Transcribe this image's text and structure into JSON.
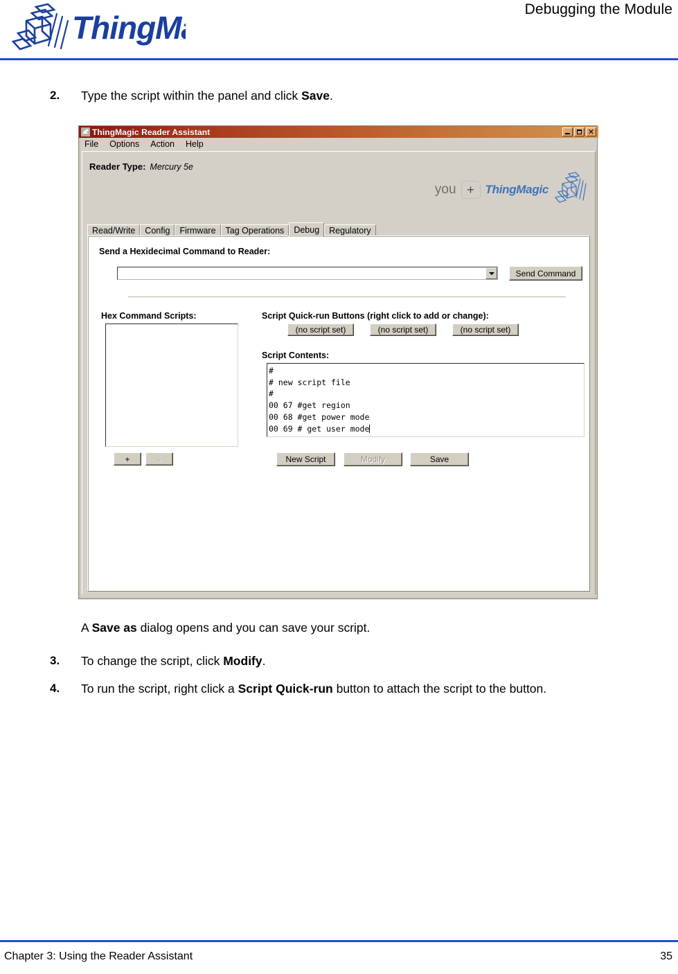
{
  "page": {
    "header_title": "Debugging the Module",
    "logo_text": "ThingMagic",
    "footer_chapter": "Chapter 3: Using the Reader Assistant",
    "footer_page_number": "35",
    "accent_color": "#1a4fd6",
    "logo_color": "#1a3f9e"
  },
  "steps": [
    {
      "number": "2.",
      "text_before": "Type the script within the panel and click ",
      "bold": "Save",
      "text_after": "."
    },
    {
      "number": "3.",
      "text_before": "To change the script, click ",
      "bold": "Modify",
      "text_after": "."
    },
    {
      "number": "4.",
      "text_before": "To run the script, right click a ",
      "bold": "Script Quick-run",
      "text_after": " button to attach the script to the button."
    }
  ],
  "result_note": {
    "text_before": "A ",
    "bold": "Save as",
    "text_after": " dialog opens and you can save your script."
  },
  "app": {
    "title": "ThingMagic Reader Assistant",
    "title_icon": "app-icon",
    "titlebar_gradient_start": "#8c1612",
    "titlebar_gradient_end": "#d09550",
    "window_controls": [
      {
        "name": "minimize",
        "glyph": "_"
      },
      {
        "name": "maximize",
        "glyph": "□"
      },
      {
        "name": "close",
        "glyph": "×"
      }
    ],
    "menu": [
      "File",
      "Options",
      "Action",
      "Help"
    ],
    "reader_type": {
      "label": "Reader Type:",
      "value": "Mercury 5e"
    },
    "branding": {
      "you": "you",
      "plus": "+",
      "name": "ThingMagic"
    },
    "tabs": [
      {
        "label": "Read/Write",
        "active": false
      },
      {
        "label": "Config",
        "active": false
      },
      {
        "label": "Firmware",
        "active": false
      },
      {
        "label": "Tag Operations",
        "active": false
      },
      {
        "label": "Debug",
        "active": true
      },
      {
        "label": "Regulatory",
        "active": false
      }
    ],
    "debug_tab": {
      "hex_command_label": "Send a Hexidecimal Command to Reader:",
      "hex_command_value": "",
      "hex_command_placeholder": "",
      "send_command_button": "Send Command",
      "hex_scripts_label": "Hex Command Scripts:",
      "hex_scripts_items": [],
      "add_button": "+",
      "remove_button": "-",
      "quickrun_label": "Script Quick-run Buttons (right click to add or change):",
      "quickrun_buttons": [
        "(no script set)",
        "(no script set)",
        "(no script set)"
      ],
      "script_contents_label": "Script Contents:",
      "script_contents_lines": [
        "#",
        "# new script file",
        "#",
        "00 67 #get region",
        "00 68 #get power mode",
        "00 69 # get user mode"
      ],
      "new_script_button": "New Script",
      "modify_button": "Modify",
      "modify_disabled": true,
      "save_button": "Save"
    }
  }
}
